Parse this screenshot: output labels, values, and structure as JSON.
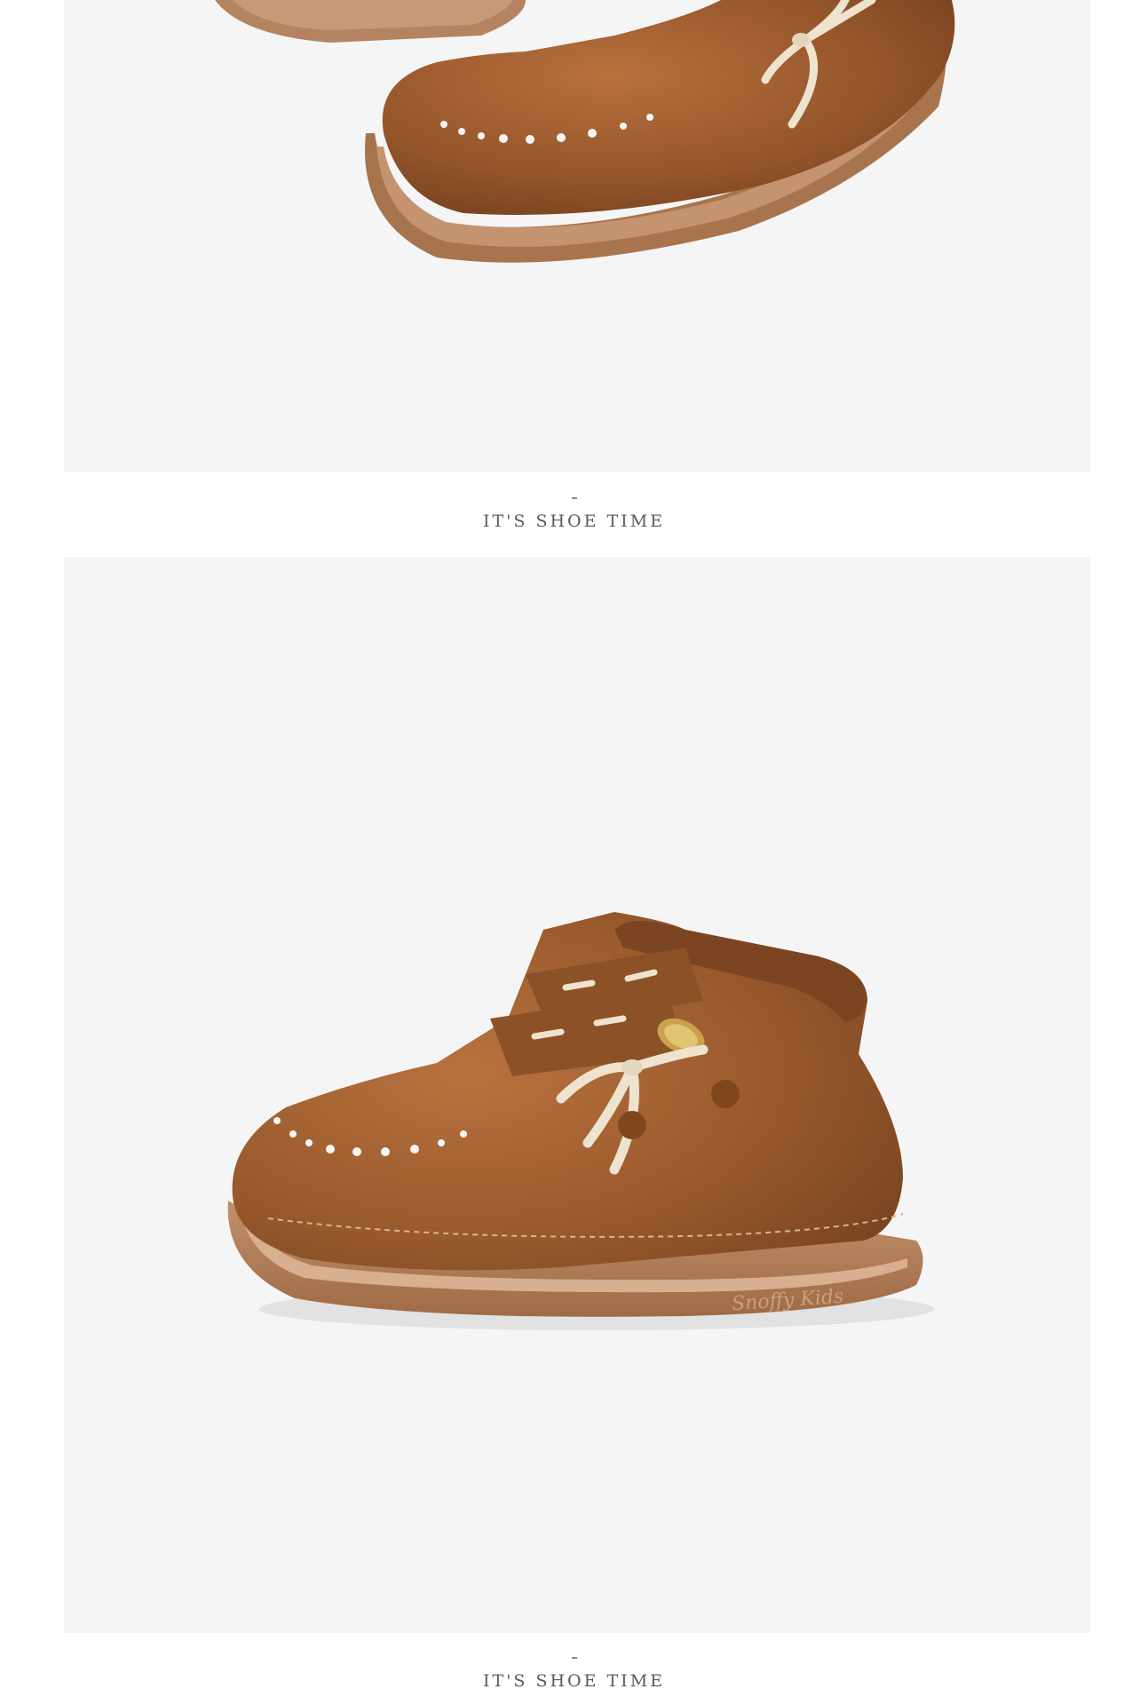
{
  "sections": [
    {
      "image_icon": "brown-leather-shoe-toe-closeup",
      "caption": "IT'S SHOE TIME"
    },
    {
      "image_icon": "brown-leather-ankle-boot-with-bow",
      "caption": "IT'S SHOE TIME",
      "logo_text": "Snoffy Kids"
    }
  ],
  "colors": {
    "panel_bg": "#f5f5f5",
    "leather": "#9a5a2e",
    "sole": "#b07a55",
    "bow": "#eee3cf",
    "caption": "#5a5a5a"
  }
}
